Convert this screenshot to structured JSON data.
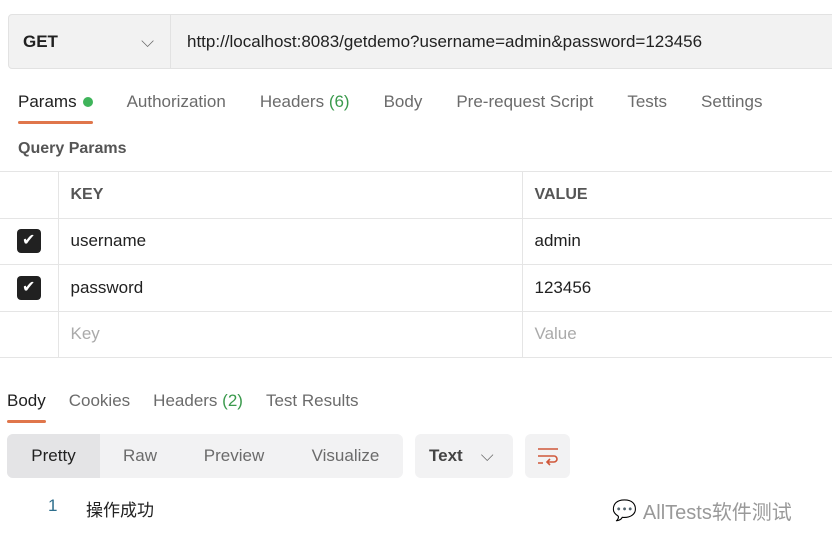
{
  "request": {
    "method": "GET",
    "url": "http://localhost:8083/getdemo?username=admin&password=123456"
  },
  "tabs": [
    {
      "label": "Params"
    },
    {
      "label": "Authorization"
    },
    {
      "label": "Headers",
      "count": "(6)"
    },
    {
      "label": "Body"
    },
    {
      "label": "Pre-request Script"
    },
    {
      "label": "Tests"
    },
    {
      "label": "Settings"
    }
  ],
  "query_params": {
    "title": "Query Params",
    "headers": [
      "KEY",
      "VALUE"
    ],
    "rows": [
      {
        "key": "username",
        "value": "admin",
        "checked": true
      },
      {
        "key": "password",
        "value": "123456",
        "checked": true
      }
    ],
    "placeholder": {
      "key": "Key",
      "value": "Value"
    }
  },
  "response": {
    "tabs": [
      {
        "label": "Body"
      },
      {
        "label": "Cookies"
      },
      {
        "label": "Headers",
        "count": "(2)"
      },
      {
        "label": "Test Results"
      }
    ],
    "views": [
      "Pretty",
      "Raw",
      "Preview",
      "Visualize"
    ],
    "format": "Text",
    "lines": [
      {
        "num": "1",
        "text": "操作成功"
      }
    ]
  },
  "watermark": "AllTests软件测试",
  "colors": {
    "accent": "#e0764b",
    "green": "#3b9a4d"
  }
}
